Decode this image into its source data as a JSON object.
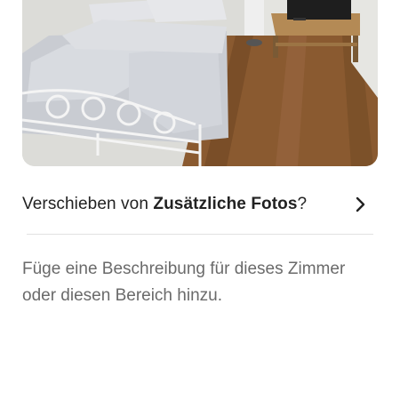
{
  "photo": {
    "icon": "room-photo"
  },
  "move": {
    "prefix": "Verschieben von ",
    "album": "Zusätzliche Fotos",
    "suffix": "?",
    "chevron_icon": "chevron-right-icon"
  },
  "description": {
    "placeholder": "Füge eine Beschreibung für dieses Zimmer oder diesen Bereich hinzu."
  },
  "colors": {
    "text": "#222222",
    "muted": "#6a6a6a",
    "divider": "#e2e2e2",
    "floor": "#8a5a30"
  }
}
